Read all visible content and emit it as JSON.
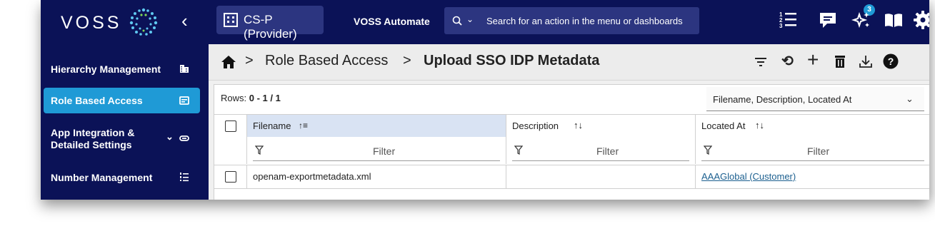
{
  "app": {
    "logo_text": "VOSS",
    "tenant_label": "CS-P (Provider)",
    "product_name": "VOSS Automate",
    "search_placeholder": "Search for an action in the menu or dashboards",
    "notification_count": "3",
    "accent_color": "#1f9ad6",
    "nav_background": "#0b1257"
  },
  "sidebar": {
    "items": [
      {
        "label": "Hierarchy Management",
        "icon": "building-icon",
        "active": false
      },
      {
        "label": "Role Based Access",
        "icon": "id-card-icon",
        "active": true
      },
      {
        "label": "App Integration &\nDetailed Settings",
        "icon": "link-icon",
        "active": false
      },
      {
        "label": "Number Management",
        "icon": "numbered-list-icon",
        "active": false
      }
    ]
  },
  "breadcrumb": {
    "section": "Role Based Access",
    "page": "Upload SSO IDP Metadata",
    "separator": ">"
  },
  "grid": {
    "rows_label": "Rows:",
    "rows_value": "0 - 1 / 1",
    "column_selector_value": "Filename, Description, Located At",
    "columns": [
      {
        "label": "Filename",
        "sorted": true
      },
      {
        "label": "Description",
        "sorted": false
      },
      {
        "label": "Located At",
        "sorted": false
      }
    ],
    "filter_placeholder": "Filter",
    "rows": [
      {
        "filename": "openam-exportmetadata.xml",
        "description": "",
        "located_at": "AAAGlobal (Customer)"
      }
    ]
  }
}
